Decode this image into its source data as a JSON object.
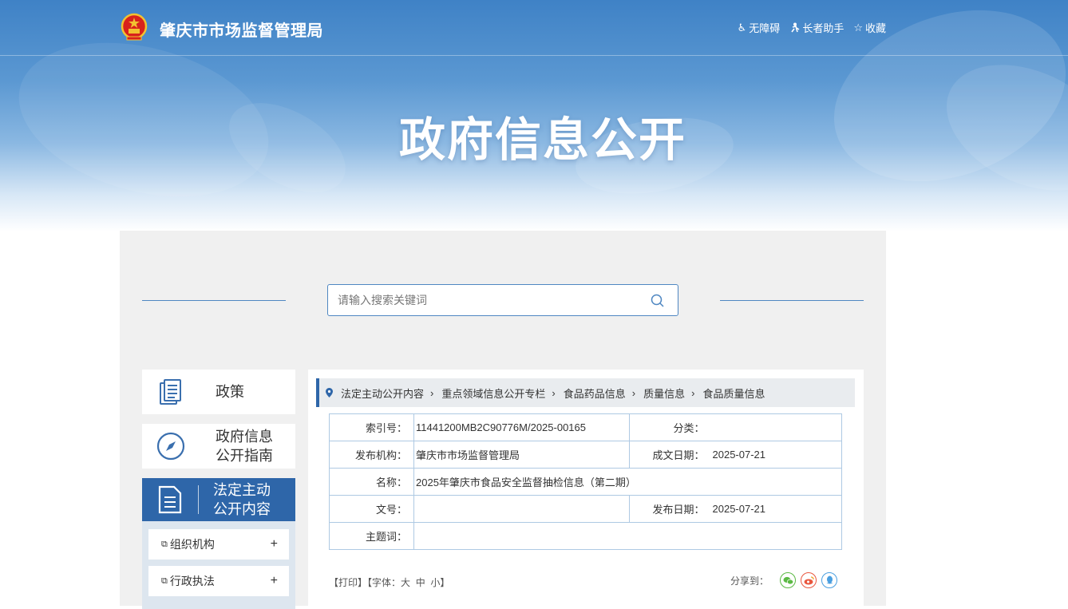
{
  "header": {
    "site_name": "肇庆市市场监督管理局",
    "tools": [
      {
        "label": "无障碍",
        "icon": "wheelchair-icon"
      },
      {
        "label": "长者助手",
        "icon": "elder-icon"
      },
      {
        "label": "收藏",
        "icon": "star-icon"
      }
    ],
    "banner_title": "政府信息公开"
  },
  "search": {
    "placeholder": "请输入搜索关键词"
  },
  "sidebar": {
    "items": [
      {
        "label": "政策",
        "icon": "book-icon"
      },
      {
        "label_line1": "政府信息",
        "label_line2": "公开指南",
        "icon": "compass-icon"
      },
      {
        "label_line1": "法定主动",
        "label_line2": "公开内容",
        "icon": "document-icon",
        "active": true
      }
    ],
    "subitems": [
      {
        "label": "组织机构",
        "expand": "+"
      },
      {
        "label": "行政执法",
        "expand": "+"
      }
    ]
  },
  "breadcrumb": [
    "法定主动公开内容",
    "重点领域信息公开专栏",
    "食品药品信息",
    "质量信息",
    "食品质量信息"
  ],
  "meta": {
    "index_label": "索引号：",
    "index_value": "11441200MB2C90776M/2025-00165",
    "category_label": "分类：",
    "category_value": "",
    "publisher_label": "发布机构：",
    "publisher_value": "肇庆市市场监督管理局",
    "created_label": "成文日期：",
    "created_value": "2025-07-21",
    "name_label": "名称：",
    "name_value": "2025年肇庆市食品安全监督抽检信息（第二期）",
    "docno_label": "文号：",
    "docno_value": "",
    "published_label": "发布日期：",
    "published_value": "2025-07-21",
    "subject_label": "主题词：",
    "subject_value": ""
  },
  "article_tools": {
    "print": "【打印】",
    "font_prefix": "【字体：",
    "font_large": "大",
    "font_medium": "中",
    "font_small": "小",
    "font_suffix": "】",
    "share_label": "分享到："
  },
  "colors": {
    "primary": "#2e66a9",
    "border": "#aec9e3",
    "wechat": "#5bb944",
    "weibo": "#e9573f",
    "qq": "#4a9fe0"
  }
}
